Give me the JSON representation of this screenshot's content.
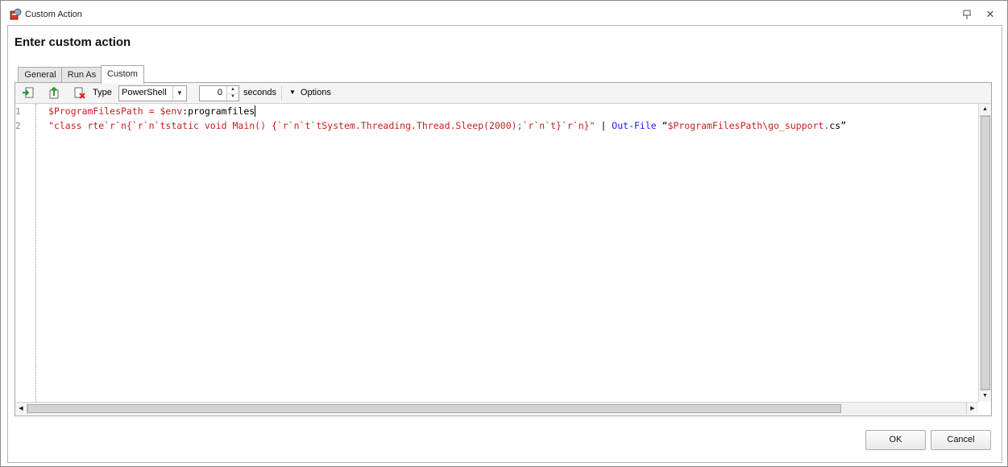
{
  "window": {
    "title": "Custom Action"
  },
  "heading": "Enter custom action",
  "tabs": [
    {
      "label": "General",
      "active": false
    },
    {
      "label": "Run As",
      "active": false
    },
    {
      "label": "Custom",
      "active": true
    }
  ],
  "toolbar": {
    "type_label": "Type",
    "type_value": "PowerShell",
    "timeout_value": "0",
    "seconds_label": "seconds",
    "options_label": "Options",
    "icons": [
      "import-icon",
      "export-icon",
      "clear-icon"
    ]
  },
  "editor": {
    "line_numbers": [
      "1",
      "2"
    ],
    "line1": {
      "var1": "$ProgramFilesPath",
      "op": " = ",
      "var2": "$env",
      "rest": ":programfiles"
    },
    "line2": {
      "string": "\"class rte`r`n{`r`n`tstatic void Main() {`r`n`t`tSystem.Threading.Thread.Sleep(2000);`r`n`t}`r`n}\"",
      "pipe": " | ",
      "cmdlet": "Out-File",
      "space": " ",
      "q1": "“",
      "pathvar": "$ProgramFilesPath\\go_support.",
      "ext": "cs",
      "q2": "”"
    }
  },
  "buttons": {
    "ok": "OK",
    "cancel": "Cancel"
  },
  "colors": {
    "variable": "#c62020",
    "cmdlet": "#1a1aff"
  }
}
